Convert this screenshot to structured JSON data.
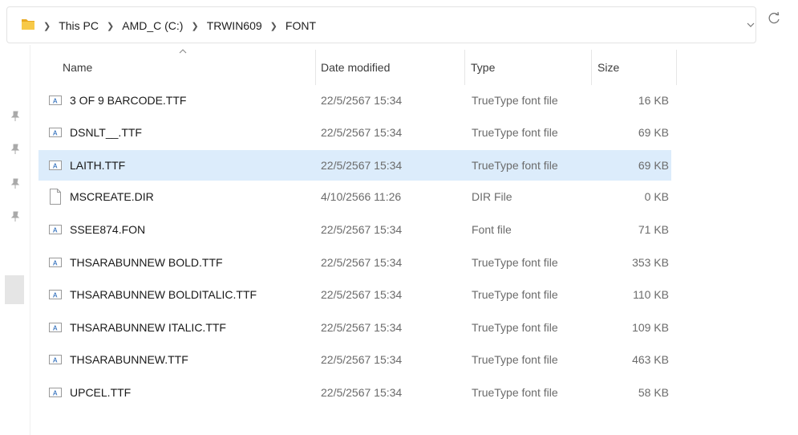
{
  "breadcrumb": [
    "This PC",
    "AMD_C (C:)",
    "TRWIN609",
    "FONT"
  ],
  "columns": {
    "name": "Name",
    "date": "Date modified",
    "type": "Type",
    "size": "Size"
  },
  "files": [
    {
      "name": "3 OF 9 BARCODE.TTF",
      "date": "22/5/2567 15:34",
      "type": "TrueType font file",
      "size": "16 KB",
      "icon": "font-file-icon"
    },
    {
      "name": "DSNLT__.TTF",
      "date": "22/5/2567 15:34",
      "type": "TrueType font file",
      "size": "69 KB",
      "icon": "font-file-icon"
    },
    {
      "name": "LAITH.TTF",
      "date": "22/5/2567 15:34",
      "type": "TrueType font file",
      "size": "69 KB",
      "icon": "font-file-icon",
      "selected": true
    },
    {
      "name": "MSCREATE.DIR",
      "date": "4/10/2566 11:26",
      "type": "DIR File",
      "size": "0 KB",
      "icon": "generic-file-icon"
    },
    {
      "name": "SSEE874.FON",
      "date": "22/5/2567 15:34",
      "type": "Font file",
      "size": "71 KB",
      "icon": "font-file-icon"
    },
    {
      "name": "THSARABUNNEW BOLD.TTF",
      "date": "22/5/2567 15:34",
      "type": "TrueType font file",
      "size": "353 KB",
      "icon": "font-file-icon"
    },
    {
      "name": "THSARABUNNEW BOLDITALIC.TTF",
      "date": "22/5/2567 15:34",
      "type": "TrueType font file",
      "size": "110 KB",
      "icon": "font-file-icon"
    },
    {
      "name": "THSARABUNNEW ITALIC.TTF",
      "date": "22/5/2567 15:34",
      "type": "TrueType font file",
      "size": "109 KB",
      "icon": "font-file-icon"
    },
    {
      "name": "THSARABUNNEW.TTF",
      "date": "22/5/2567 15:34",
      "type": "TrueType font file",
      "size": "463 KB",
      "icon": "font-file-icon"
    },
    {
      "name": "UPCEL.TTF",
      "date": "22/5/2567 15:34",
      "type": "TrueType font file",
      "size": "58 KB",
      "icon": "font-file-icon"
    }
  ],
  "colors": {
    "selected_row": "#dcecfb",
    "folder": "#f4c430"
  }
}
